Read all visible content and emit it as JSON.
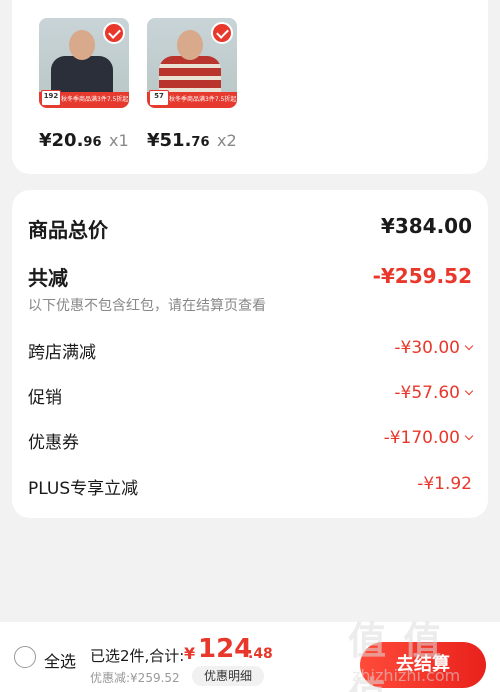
{
  "products": [
    {
      "price_main": "¥20.",
      "price_dec": "96",
      "qty": "x1",
      "sales_tag": "192",
      "banner": "秋冬季商品满3件7.5折起",
      "shirt_color": "#2a2f3a"
    },
    {
      "price_main": "¥51.",
      "price_dec": "76",
      "qty": "x2",
      "sales_tag": "57",
      "banner": "秋冬季商品满3件7.5折起",
      "shirt_color": "#b8342c"
    }
  ],
  "summary": {
    "total_label": "商品总价",
    "total_value": "¥384.00",
    "reduce_label": "共减",
    "reduce_value": "-¥259.52",
    "reduce_note": "以下优惠不包含红包，请在结算页查看",
    "rows": [
      {
        "label": "跨店满减",
        "value": "-¥30.00"
      },
      {
        "label": "促销",
        "value": "-¥57.60"
      },
      {
        "label": "优惠券",
        "value": "-¥170.00"
      },
      {
        "label": "PLUS专享立减",
        "value": "-¥1.92"
      }
    ]
  },
  "bottom": {
    "select_all": "全选",
    "selected_count": "已选2件,合计:",
    "currency": "¥",
    "total_main": "124",
    "total_dec": ".48",
    "discount_note": "优惠减:¥259.52",
    "detail_button": "优惠明细",
    "checkout_button": "去结算"
  },
  "watermark": {
    "big": "值 值 值",
    "small": "zhizhizhi.com"
  },
  "colors": {
    "accent": "#e8382b",
    "background": "#f2f2f2"
  }
}
